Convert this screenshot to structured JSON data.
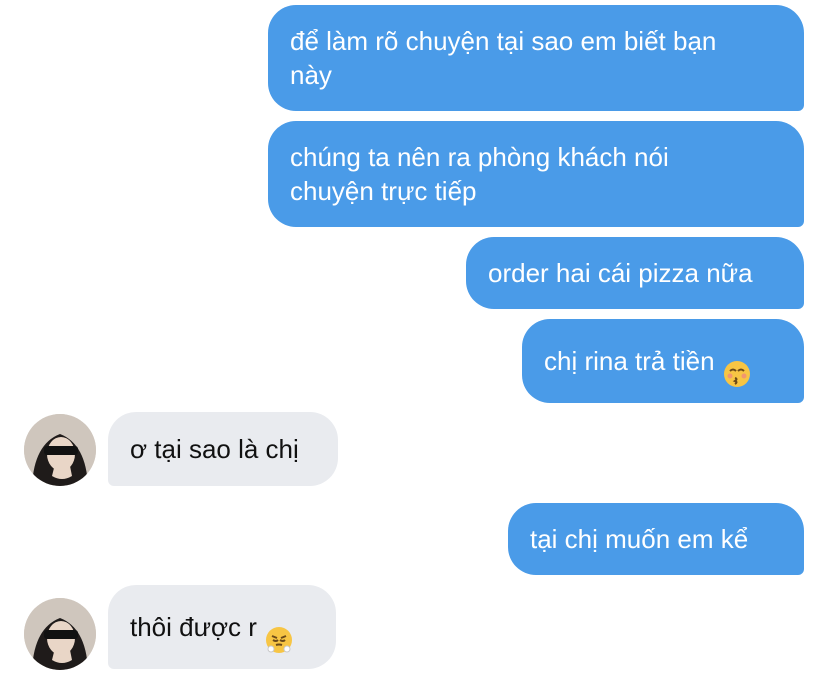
{
  "messages": [
    {
      "side": "out",
      "text": "để làm rõ chuyện tại sao em biết bạn\nnày"
    },
    {
      "side": "out",
      "text": "chúng ta nên ra phòng khách nói\nchuyện trực tiếp"
    },
    {
      "side": "out",
      "text": "order hai cái pizza nữa"
    },
    {
      "side": "out",
      "text": "chị rina trả tiền",
      "emoji": "kissing-face-emoji"
    },
    {
      "side": "in",
      "text": "ơ tại sao là chị"
    },
    {
      "side": "out",
      "text": "tại chị muốn em kể"
    },
    {
      "side": "in",
      "text": "thôi được r",
      "emoji": "steam-from-nose-emoji"
    }
  ],
  "colors": {
    "outgoing_bubble": "#4a9be8",
    "incoming_bubble": "#e9ebef"
  }
}
